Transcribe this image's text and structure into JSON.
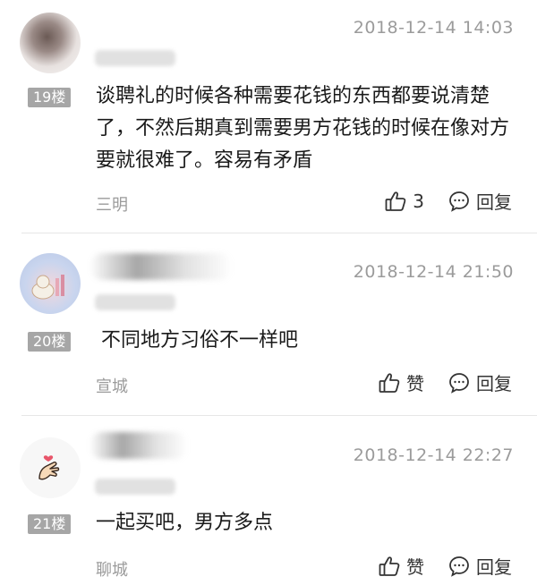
{
  "comments": [
    {
      "timestamp": "2018-12-14 14:03",
      "floor": "19楼",
      "content": "谈聘礼的时候各种需要花钱的东西都要说清楚了，不然后期真到需要男方花钱的时候在像对方要就很难了。容易有矛盾",
      "location": "三明",
      "like_label": "3",
      "reply_label": "回复",
      "avatar_icon": "photo-avatar-icon"
    },
    {
      "timestamp": "2018-12-14 21:50",
      "floor": "20楼",
      "content": "不同地方习俗不一样吧",
      "location": "宣城",
      "like_label": "赞",
      "reply_label": "回复",
      "avatar_icon": "cartoon-avatar-icon"
    },
    {
      "timestamp": "2018-12-14 22:27",
      "floor": "21楼",
      "content": "一起买吧，男方多点",
      "location": "聊城",
      "like_label": "赞",
      "reply_label": "回复",
      "avatar_icon": "finger-heart-avatar-icon"
    }
  ],
  "colors": {
    "badge": "#a6a6a6",
    "meta_text": "#9b9b9b",
    "body_text": "#1a1a1a",
    "divider": "#e6e6e6"
  }
}
